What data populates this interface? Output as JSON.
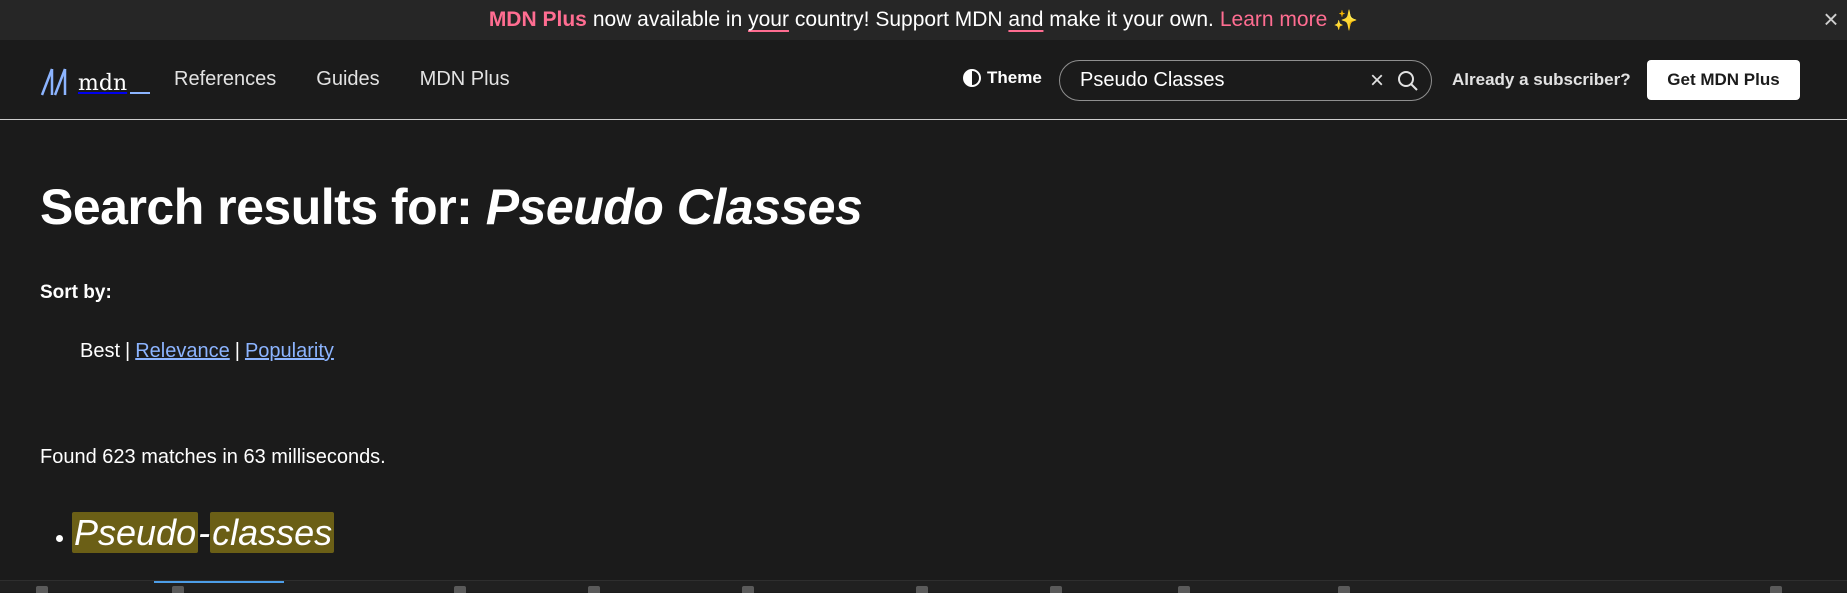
{
  "banner": {
    "brand": "MDN Plus",
    "text_pre": "now available in",
    "text_your": "your",
    "text_mid": "country! Support MDN",
    "text_and": "and",
    "text_post": "make it your own.",
    "learn_more": "Learn more",
    "sparkle": "✨",
    "close": "×"
  },
  "header": {
    "logo_text": "mdn",
    "nav": [
      "References",
      "Guides",
      "MDN Plus"
    ],
    "theme_label": "Theme",
    "search": {
      "value": "Pseudo Classes",
      "clear": "×"
    },
    "subscriber_label": "Already a subscriber?",
    "get_plus_label": "Get MDN Plus"
  },
  "main": {
    "title_prefix": "Search results for:",
    "title_query": "Pseudo Classes",
    "sort_by_label": "Sort by:",
    "sort_options": {
      "best": "Best",
      "relevance": "Relevance",
      "popularity": "Popularity",
      "separator": "|"
    },
    "found_text": "Found 623 matches in 63 milliseconds.",
    "results": [
      {
        "part1": "Pseudo",
        "dash": "-",
        "part2": "classes"
      }
    ]
  },
  "colors": {
    "background": "#1b1b1b",
    "banner_bg": "#262626",
    "accent_pink": "#ff6d91",
    "link_blue": "#8cb4ff",
    "highlight": "#6b5f16"
  }
}
